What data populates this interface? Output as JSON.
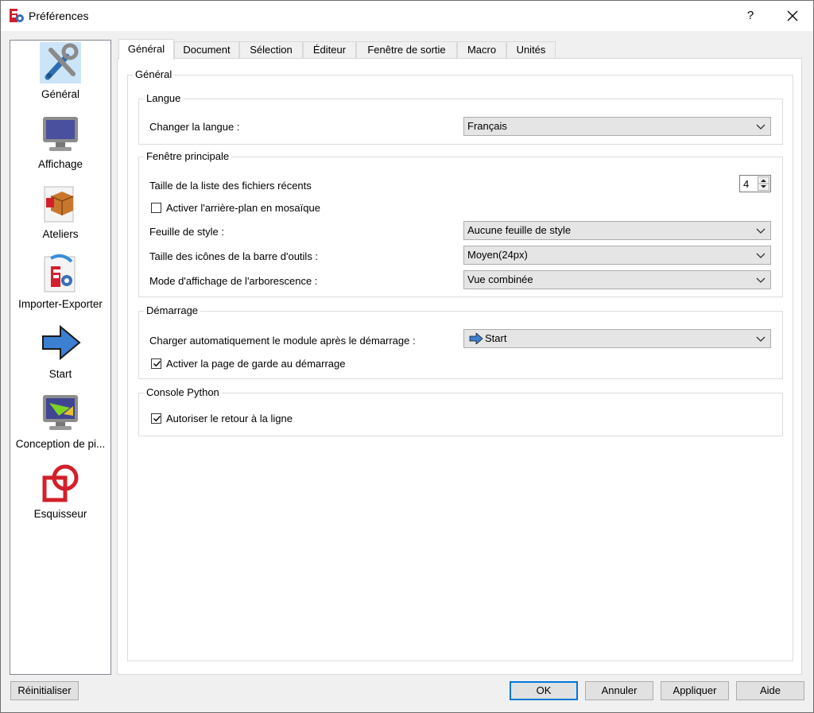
{
  "window": {
    "title": "Préférences",
    "help": "?",
    "close": "✕"
  },
  "sidebar": {
    "items": [
      {
        "label": "Général",
        "icon": "tools-icon"
      },
      {
        "label": "Affichage",
        "icon": "monitor-icon"
      },
      {
        "label": "Ateliers",
        "icon": "workbench-box-icon"
      },
      {
        "label": "Importer-Exporter",
        "icon": "import-export-icon"
      },
      {
        "label": "Start",
        "icon": "start-arrow-icon"
      },
      {
        "label": "Conception de pi...",
        "icon": "part-design-icon"
      },
      {
        "label": "Esquisseur",
        "icon": "sketcher-icon"
      }
    ]
  },
  "tabs": [
    "Général",
    "Document",
    "Sélection",
    "Éditeur",
    "Fenêtre de sortie",
    "Macro",
    "Unités"
  ],
  "panel": {
    "outer_title": "Général",
    "langue": {
      "title": "Langue",
      "change_label": "Changer la langue :",
      "language_value": "Français"
    },
    "fenetre": {
      "title": "Fenêtre principale",
      "recent_label": "Taille de la liste des fichiers récents",
      "recent_value": "4",
      "tile_bg_label": "Activer l'arrière-plan en mosaïque",
      "tile_bg_checked": false,
      "style_label": "Feuille de style :",
      "style_value": "Aucune feuille de style",
      "icon_size_label": "Taille des icônes de la barre d'outils :",
      "icon_size_value": "Moyen(24px)",
      "tree_mode_label": "Mode d'affichage de l'arborescence :",
      "tree_mode_value": "Vue combinée"
    },
    "demarrage": {
      "title": "Démarrage",
      "autoload_label": "Charger automatiquement le module après le démarrage :",
      "autoload_value": "Start",
      "start_page_label": "Activer la page de garde au démarrage",
      "start_page_checked": true
    },
    "console": {
      "title": "Console Python",
      "wrap_label": "Autoriser le retour à la ligne",
      "wrap_checked": true
    }
  },
  "footer": {
    "reset": "Réinitialiser",
    "ok": "OK",
    "cancel": "Annuler",
    "apply": "Appliquer",
    "help": "Aide"
  },
  "colors": {
    "accent": "#0078d7",
    "selection": "#cce4f7"
  }
}
